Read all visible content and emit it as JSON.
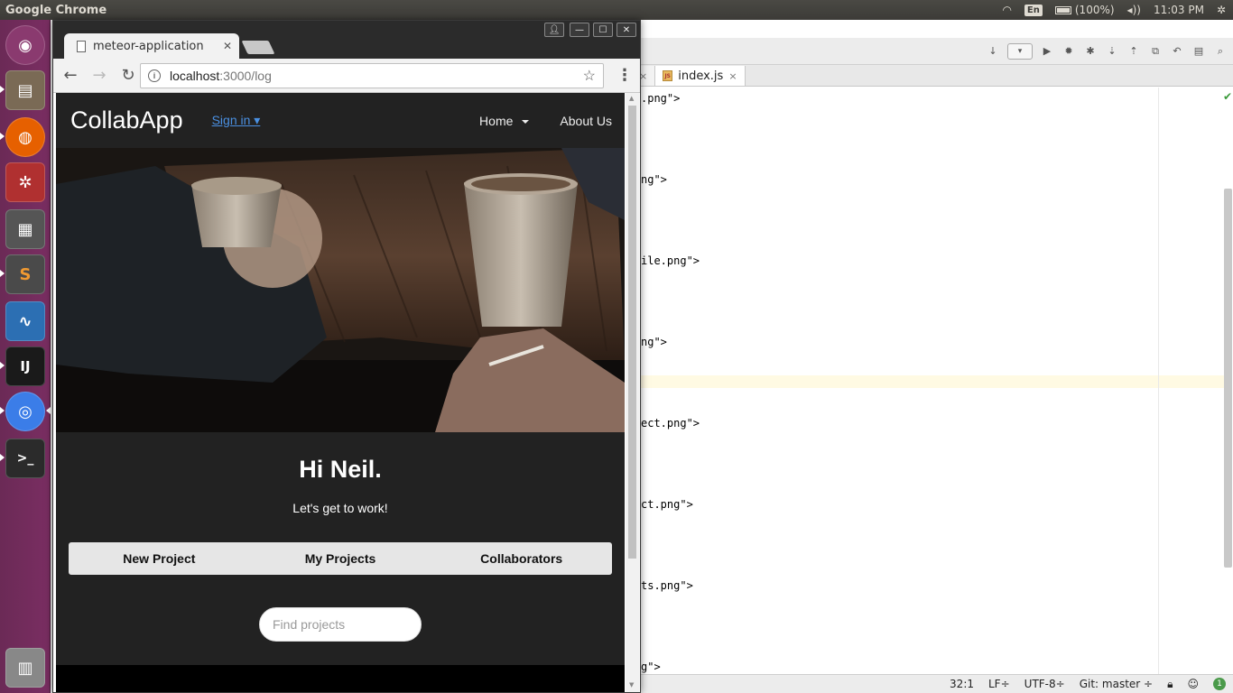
{
  "os": {
    "app_title": "Google Chrome",
    "lang": "En",
    "battery": "(100%)",
    "time": "11:03 PM"
  },
  "launcher": {
    "items": [
      {
        "name": "ubuntu-dash-icon",
        "glyph": "◉",
        "color": "#8a3a6f"
      },
      {
        "name": "file-manager-icon",
        "glyph": "▤",
        "color": "#7a6a55"
      },
      {
        "name": "firefox-icon",
        "glyph": "◍",
        "color": "#e66000"
      },
      {
        "name": "system-settings-icon",
        "glyph": "✲",
        "color": "#b03030"
      },
      {
        "name": "calculator-icon",
        "glyph": "▦",
        "color": "#555555"
      },
      {
        "name": "sublime-text-icon",
        "glyph": "S",
        "color": "#4a4a4a"
      },
      {
        "name": "system-monitor-icon",
        "glyph": "∿",
        "color": "#2c6fb3"
      },
      {
        "name": "intellij-icon",
        "glyph": "IJ",
        "color": "#1a1a1a"
      },
      {
        "name": "chrome-icon",
        "glyph": "◎",
        "color": "#3b7de8"
      },
      {
        "name": "terminal-icon",
        "glyph": ">_",
        "color": "#2b2b2b"
      },
      {
        "name": "trash-icon",
        "glyph": "▥",
        "color": "#888888"
      }
    ]
  },
  "ide": {
    "tab_label": "index.js",
    "js_badge": "JS",
    "lines": [
      ".png\">",
      "ng\">",
      "ile.png\">",
      "ng\">",
      "ect.png\">",
      "ct.png\">",
      "ts.png\">",
      "g\">"
    ],
    "status": {
      "position": "32:1",
      "line_sep": "LF÷",
      "encoding": "UTF-8÷",
      "branch": "Git: master ÷",
      "notifications": "1"
    }
  },
  "browser": {
    "tab_title": "meteor-application",
    "url_host": "localhost",
    "url_path": ":3000/log"
  },
  "site": {
    "brand": "CollabApp",
    "signin": "Sign in ▾",
    "nav": {
      "home": "Home",
      "about": "About Us"
    },
    "greeting": "Hi Neil.",
    "subtitle": "Let's get to work!",
    "buttons": [
      "New Project",
      "My Projects",
      "Collaborators"
    ],
    "search_placeholder": "Find projects"
  }
}
